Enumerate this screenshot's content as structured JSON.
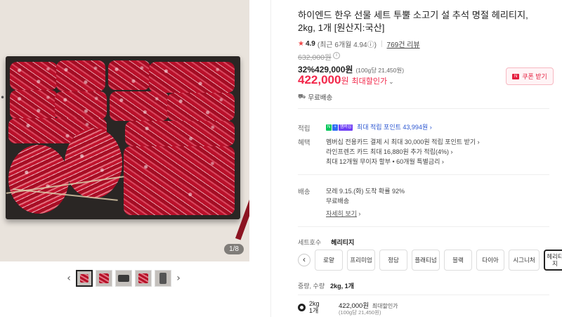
{
  "gallery": {
    "counter": "1/8",
    "prev_icon": "chevron-left-icon",
    "next_icon": "chevron-right-icon",
    "prev_glyph": "‹",
    "next_glyph": "›",
    "thumb_count": 5
  },
  "product": {
    "title": "하이엔드 한우 선물 세트 투뿔 소고기 설 추석 명절 헤리티지, 2kg, 1개 [원산지:국산]",
    "rating": "4.9",
    "rating_recent": "(최근 6개월 4.94",
    "review_link": "769건 리뷰",
    "original_price": "632,000원",
    "discount_rate": "32%",
    "sale_price": "429,000원",
    "unit_price": "(100g당 21,450원)",
    "final_price": "422,000",
    "final_won": "원",
    "max_discount_label": "최대할인가",
    "coupon_button": "쿠폰 받기",
    "shipping_free": "무료배송"
  },
  "benefits": {
    "points_label": "적립",
    "npay_badges": [
      "N",
      "+",
      "멤버십"
    ],
    "points_text": "최대 적립 포인트 43,994원",
    "card_label": "혜택",
    "card_lines": [
      "멤버십 전용카드 결제 시 최대 30,000원 적립 포인트 받기",
      "라인프렌즈 카드 최대 16,880원 추가 적립(4%)",
      "최대 12개월 무이자 할부 • 60개월 특별금리"
    ]
  },
  "delivery": {
    "label": "배송",
    "eta": "모레 9.15.(화) 도착 확률 92%",
    "fee": "무료배송",
    "detail_link": "자세히 보기"
  },
  "options": {
    "set_label": "세트호수",
    "set_selected": "헤리티지",
    "chips": [
      "로얄",
      "프리미엄",
      "정담",
      "플래티넘",
      "블랙",
      "다이아",
      "시그니처"
    ],
    "selected_chip": "헤리티지",
    "weight_label": "중량, 수량",
    "weight_selected": "2kg, 1개",
    "option_row": {
      "name": "2kg",
      "qty": "1개",
      "price": "422,000원",
      "price_note": "최대할인가",
      "unit": "(100g당 21,450원)"
    }
  },
  "colors": {
    "accent_red": "#f2274a",
    "point_blue": "#2a55d0"
  }
}
